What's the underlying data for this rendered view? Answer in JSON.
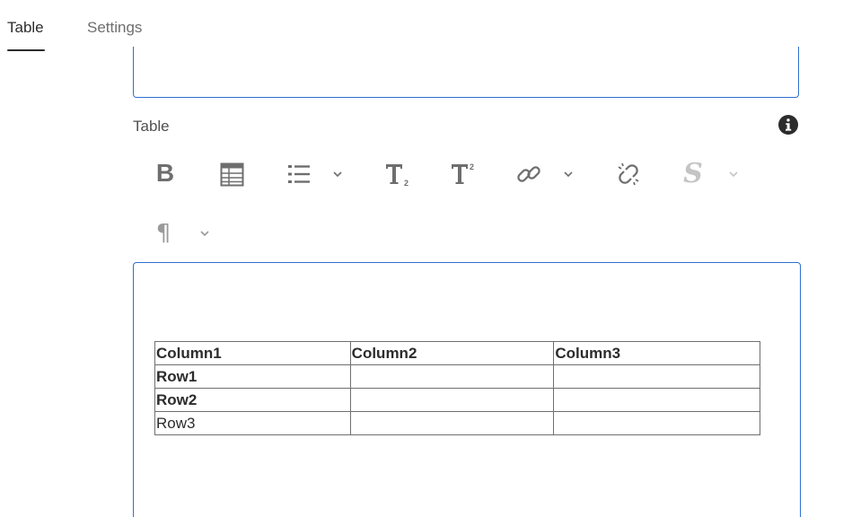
{
  "tabs": [
    {
      "label": "Table",
      "active": true
    },
    {
      "label": "Settings",
      "active": false
    }
  ],
  "field": {
    "label": "Table"
  },
  "toolbar": {
    "bold_label": "B",
    "paragraph_label": "¶",
    "strikethrough_label": "S",
    "icons": [
      "bold-icon",
      "table-icon",
      "list-icon",
      "subscript-icon",
      "superscript-icon",
      "link-icon",
      "unlink-icon",
      "strikethrough-icon",
      "paragraph-icon"
    ]
  },
  "table": {
    "header": [
      "Column1",
      "Column2",
      "Column3"
    ],
    "rows": [
      [
        "Row1",
        "",
        ""
      ],
      [
        "Row2",
        "",
        ""
      ],
      [
        "Row3",
        "",
        ""
      ]
    ]
  },
  "colors": {
    "accent": "#2f6fd0",
    "text": "#2c2c2c",
    "muted": "#6e6e6e"
  }
}
